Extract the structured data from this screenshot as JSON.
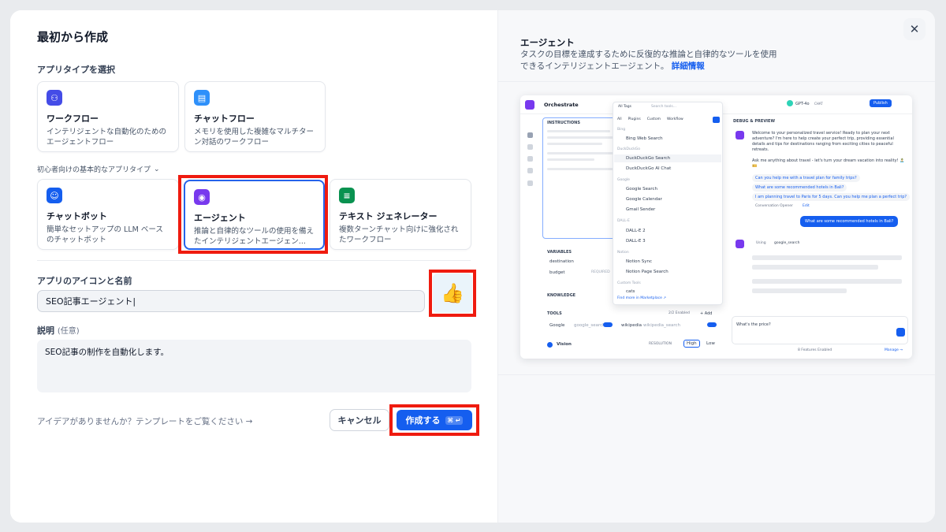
{
  "dialog": {
    "title": "最初から作成",
    "app_type_label": "アプリタイプを選択",
    "beginner_label": "初心者向けの基本的なアプリタイプ",
    "close_icon": "close-icon"
  },
  "app_types": [
    {
      "title": "ワークフロー",
      "desc": "インテリジェントな自動化のためのエージェントフロー",
      "icon": "workflow-icon",
      "color": "#444ce7"
    },
    {
      "title": "チャットフロー",
      "desc": "メモリを使用した複雑なマルチターン対話のワークフロー",
      "icon": "chatflow-icon",
      "color": "#2e90fa"
    }
  ],
  "basic_types": [
    {
      "title": "チャットボット",
      "desc": "簡単なセットアップの LLM ベースのチャットボット",
      "icon": "chatbot-icon",
      "color": "#155eef"
    },
    {
      "title": "エージェント",
      "desc": "推論と自律的なツールの使用を備えたインテリジェントエージェン...",
      "icon": "agent-icon",
      "color": "#7839ee"
    },
    {
      "title": "テキスト ジェネレーター",
      "desc": "複数ターンチャット向けに強化されたワークフロー",
      "icon": "text-generator-icon",
      "color": "#099250"
    }
  ],
  "form": {
    "icon_name_label": "アプリのアイコンと名前",
    "app_name_value": "SEO記事エージェント",
    "app_emoji": "👍",
    "desc_label": "説明",
    "desc_optional": "(任意)",
    "desc_value": "SEO記事の制作を自動化します。"
  },
  "footer": {
    "hint": "アイデアがありませんか？テンプレートをご覧ください →",
    "cancel_label": "キャンセル",
    "create_label": "作成する",
    "create_shortcut": "⌘ ↵"
  },
  "preview": {
    "title": "エージェント",
    "desc": "タスクの目標を達成するために反復的な推論と自律的なツールを使用できるインテリジェントエージェント。",
    "link": "詳細情報",
    "screenshot": {
      "app_name": "Orchestrate",
      "instructions": "INSTRUCTIONS",
      "variables": "VARIABLES",
      "var1": "destination",
      "var2": "budget",
      "required": "REQUIRED",
      "knowledge": "KNOWLEDGE",
      "tools": "TOOLS",
      "tools_enabled": "2/2 Enabled",
      "add": "+ Add",
      "tool1": "Google",
      "tool1_id": "google_search",
      "tool2": "wikipedia",
      "tool2_id": "wikipedia_search",
      "vision": "Vision",
      "resolution": "RESOLUTION",
      "high": "High",
      "low": "Low",
      "all_tags": "All Tags",
      "search_tools": "Search tools...",
      "filter_tabs": [
        "All",
        "Plugins",
        "Custom",
        "Workflow"
      ],
      "groups": [
        {
          "group": "Bing",
          "items": [
            "Bing Web Search"
          ]
        },
        {
          "group": "DuckDuckGo",
          "items": [
            "DuckDuckGo Search",
            "DuckDuckGo AI Chat"
          ]
        },
        {
          "group": "Google",
          "items": [
            "Google Search",
            "Google Calendar",
            "Gmail Sender"
          ]
        },
        {
          "group": "DALL-E",
          "items": [
            "DALL-E 2",
            "DALL-E 3"
          ]
        },
        {
          "group": "Notion",
          "items": [
            "Notion Sync",
            "Notion Page Search"
          ]
        },
        {
          "group": "Custom Tools",
          "items": [
            "cats"
          ]
        }
      ],
      "find_more": "Find more in Marketplace ↗",
      "model": "GPT-4o",
      "chat_badge": "CHAT",
      "publish": "Publish",
      "debug": "DEBUG & PREVIEW",
      "welcome": "Welcome to your personalized travel service! Ready to plan your next adventure? I'm here to help create your perfect trip, providing essential details and tips for destinations ranging from exciting cities to peaceful retreats.",
      "ask": "Ask me anything about travel - let's turn your dream vacation into reality! 🏝️ 🎫",
      "suggest1": "Can you help me with a travel plan for family trips?",
      "suggest2": "What are some recommended hotels in Bali?",
      "suggest3": "I am planning travel to Paris for 5 days. Can you help me plan a perfect trip?",
      "opener": "Conversation Opener",
      "edit": "Edit",
      "user_msg": "What are some recommended hotels in Bali?",
      "using": "Using",
      "using_tool": "google_search",
      "input_text": "What's the price?",
      "features": "8 Features Enabled",
      "manage": "Manage →"
    }
  }
}
